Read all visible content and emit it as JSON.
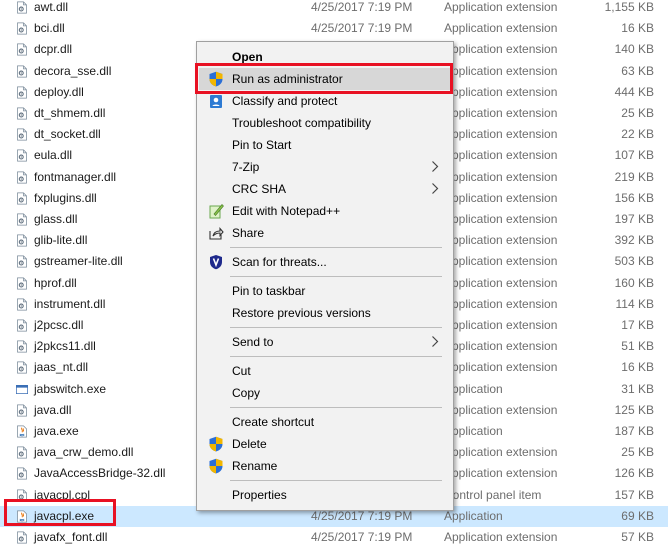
{
  "files": [
    {
      "name": "awt.dll",
      "date": "4/25/2017 7:19 PM",
      "type": "Application extension",
      "size": "1,155 KB",
      "icon": "dll-file-icon"
    },
    {
      "name": "bci.dll",
      "date": "4/25/2017 7:19 PM",
      "type": "Application extension",
      "size": "16 KB",
      "icon": "dll-file-icon"
    },
    {
      "name": "dcpr.dll",
      "date": "",
      "type": "Application extension",
      "size": "140 KB",
      "icon": "dll-file-icon"
    },
    {
      "name": "decora_sse.dll",
      "date": "",
      "type": "Application extension",
      "size": "63 KB",
      "icon": "dll-file-icon"
    },
    {
      "name": "deploy.dll",
      "date": "",
      "type": "Application extension",
      "size": "444 KB",
      "icon": "dll-file-icon"
    },
    {
      "name": "dt_shmem.dll",
      "date": "",
      "type": "Application extension",
      "size": "25 KB",
      "icon": "dll-file-icon"
    },
    {
      "name": "dt_socket.dll",
      "date": "",
      "type": "Application extension",
      "size": "22 KB",
      "icon": "dll-file-icon"
    },
    {
      "name": "eula.dll",
      "date": "",
      "type": "Application extension",
      "size": "107 KB",
      "icon": "dll-file-icon"
    },
    {
      "name": "fontmanager.dll",
      "date": "",
      "type": "Application extension",
      "size": "219 KB",
      "icon": "dll-file-icon"
    },
    {
      "name": "fxplugins.dll",
      "date": "",
      "type": "Application extension",
      "size": "156 KB",
      "icon": "dll-file-icon"
    },
    {
      "name": "glass.dll",
      "date": "",
      "type": "Application extension",
      "size": "197 KB",
      "icon": "dll-file-icon"
    },
    {
      "name": "glib-lite.dll",
      "date": "",
      "type": "Application extension",
      "size": "392 KB",
      "icon": "dll-file-icon"
    },
    {
      "name": "gstreamer-lite.dll",
      "date": "",
      "type": "Application extension",
      "size": "503 KB",
      "icon": "dll-file-icon"
    },
    {
      "name": "hprof.dll",
      "date": "",
      "type": "Application extension",
      "size": "160 KB",
      "icon": "dll-file-icon"
    },
    {
      "name": "instrument.dll",
      "date": "",
      "type": "Application extension",
      "size": "114 KB",
      "icon": "dll-file-icon"
    },
    {
      "name": "j2pcsc.dll",
      "date": "",
      "type": "Application extension",
      "size": "17 KB",
      "icon": "dll-file-icon"
    },
    {
      "name": "j2pkcs11.dll",
      "date": "",
      "type": "Application extension",
      "size": "51 KB",
      "icon": "dll-file-icon"
    },
    {
      "name": "jaas_nt.dll",
      "date": "",
      "type": "Application extension",
      "size": "16 KB",
      "icon": "dll-file-icon"
    },
    {
      "name": "jabswitch.exe",
      "date": "",
      "type": "Application",
      "size": "31 KB",
      "icon": "window-exe-icon"
    },
    {
      "name": "java.dll",
      "date": "",
      "type": "Application extension",
      "size": "125 KB",
      "icon": "dll-file-icon"
    },
    {
      "name": "java.exe",
      "date": "",
      "type": "Application",
      "size": "187 KB",
      "icon": "java-icon"
    },
    {
      "name": "java_crw_demo.dll",
      "date": "",
      "type": "Application extension",
      "size": "25 KB",
      "icon": "dll-file-icon"
    },
    {
      "name": "JavaAccessBridge-32.dll",
      "date": "",
      "type": "Application extension",
      "size": "126 KB",
      "icon": "dll-file-icon"
    },
    {
      "name": "javacpl.cpl",
      "date": "",
      "type": "Control panel item",
      "size": "157 KB",
      "icon": "dll-file-icon"
    },
    {
      "name": "javacpl.exe",
      "date": "4/25/2017 7:19 PM",
      "type": "Application",
      "size": "69 KB",
      "icon": "java-icon"
    },
    {
      "name": "javafx_font.dll",
      "date": "4/25/2017 7:19 PM",
      "type": "Application extension",
      "size": "57 KB",
      "icon": "dll-file-icon"
    }
  ],
  "selected_file_index": 24,
  "context_menu": {
    "items": [
      {
        "label": "Open",
        "bold": true,
        "icon": "",
        "submenu": false,
        "sep_before": false,
        "highlighted": false
      },
      {
        "label": "Run as administrator",
        "bold": false,
        "icon": "uac-shield-icon",
        "submenu": false,
        "sep_before": false,
        "highlighted": true
      },
      {
        "label": "Classify and protect",
        "bold": false,
        "icon": "classify-protect-icon",
        "submenu": false,
        "sep_before": false,
        "highlighted": false
      },
      {
        "label": "Troubleshoot compatibility",
        "bold": false,
        "icon": "",
        "submenu": false,
        "sep_before": false,
        "highlighted": false
      },
      {
        "label": "Pin to Start",
        "bold": false,
        "icon": "",
        "submenu": false,
        "sep_before": false,
        "highlighted": false
      },
      {
        "label": "7-Zip",
        "bold": false,
        "icon": "",
        "submenu": true,
        "sep_before": false,
        "highlighted": false
      },
      {
        "label": "CRC SHA",
        "bold": false,
        "icon": "",
        "submenu": true,
        "sep_before": false,
        "highlighted": false
      },
      {
        "label": "Edit with Notepad++",
        "bold": false,
        "icon": "notepad-plus-plus-icon",
        "submenu": false,
        "sep_before": false,
        "highlighted": false
      },
      {
        "label": "Share",
        "bold": false,
        "icon": "share-icon",
        "submenu": false,
        "sep_before": false,
        "highlighted": false
      },
      {
        "label": "Scan for threats...",
        "bold": false,
        "icon": "antivirus-shield-icon",
        "submenu": false,
        "sep_before": true,
        "highlighted": false
      },
      {
        "label": "Pin to taskbar",
        "bold": false,
        "icon": "",
        "submenu": false,
        "sep_before": true,
        "highlighted": false
      },
      {
        "label": "Restore previous versions",
        "bold": false,
        "icon": "",
        "submenu": false,
        "sep_before": false,
        "highlighted": false
      },
      {
        "label": "Send to",
        "bold": false,
        "icon": "",
        "submenu": true,
        "sep_before": true,
        "highlighted": false
      },
      {
        "label": "Cut",
        "bold": false,
        "icon": "",
        "submenu": false,
        "sep_before": true,
        "highlighted": false
      },
      {
        "label": "Copy",
        "bold": false,
        "icon": "",
        "submenu": false,
        "sep_before": false,
        "highlighted": false
      },
      {
        "label": "Create shortcut",
        "bold": false,
        "icon": "",
        "submenu": false,
        "sep_before": true,
        "highlighted": false
      },
      {
        "label": "Delete",
        "bold": false,
        "icon": "uac-shield-icon",
        "submenu": false,
        "sep_before": false,
        "highlighted": false
      },
      {
        "label": "Rename",
        "bold": false,
        "icon": "uac-shield-icon",
        "submenu": false,
        "sep_before": false,
        "highlighted": false
      },
      {
        "label": "Properties",
        "bold": false,
        "icon": "",
        "submenu": false,
        "sep_before": true,
        "highlighted": false
      }
    ]
  },
  "colors": {
    "selection": "#cce8ff",
    "menu_bg": "#f2f2f2",
    "menu_highlight": "#d7d7d7",
    "callout": "#e81123",
    "secondary_text": "#6d6d6d"
  }
}
